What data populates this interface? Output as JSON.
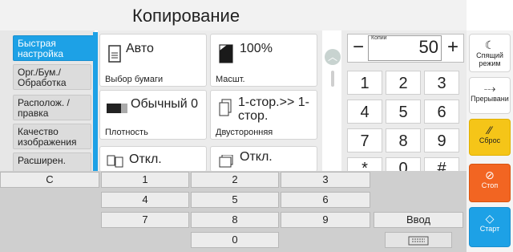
{
  "title": "Копирование",
  "nav": {
    "tabs": [
      {
        "label": "Быстрая настройка",
        "active": true
      },
      {
        "label": "Орг./Бум./ Обработка",
        "active": false
      },
      {
        "label": "Располож. /правка",
        "active": false
      },
      {
        "label": "Качество изображения",
        "active": false
      },
      {
        "label": "Расширен.",
        "active": false
      }
    ]
  },
  "settings": {
    "paper": {
      "value": "Авто",
      "label": "Выбор бумаги"
    },
    "zoom": {
      "value": "100%",
      "label": "Масшт."
    },
    "density": {
      "value": "Обычный 0",
      "label": "Плотность"
    },
    "duplex": {
      "value": "1-стор.>> 1-стор.",
      "label": "Двусторонняя"
    },
    "card5": {
      "value": "Откл."
    },
    "card6": {
      "value": "Откл."
    }
  },
  "copies": {
    "label": "Копии",
    "value": "50",
    "minus": "−",
    "plus": "+"
  },
  "keypad": {
    "keys": [
      "1",
      "2",
      "3",
      "4",
      "5",
      "6",
      "7",
      "8",
      "9",
      "*",
      "0",
      "#"
    ]
  },
  "rightbar": {
    "sleep": "Спящий режим",
    "interrupt": "Прерывани",
    "reset": "Сброс",
    "stop": "Стоп",
    "start": "Старт"
  },
  "keyboard": {
    "c": "C",
    "rows": [
      [
        "1",
        "2",
        "3"
      ],
      [
        "4",
        "5",
        "6"
      ],
      [
        "7",
        "8",
        "9"
      ],
      [
        "0"
      ]
    ],
    "enter": "Ввод"
  },
  "colors": {
    "accent": "#1da1e6",
    "reset": "#f5c518",
    "stop": "#f26522",
    "start": "#1da1e6"
  }
}
